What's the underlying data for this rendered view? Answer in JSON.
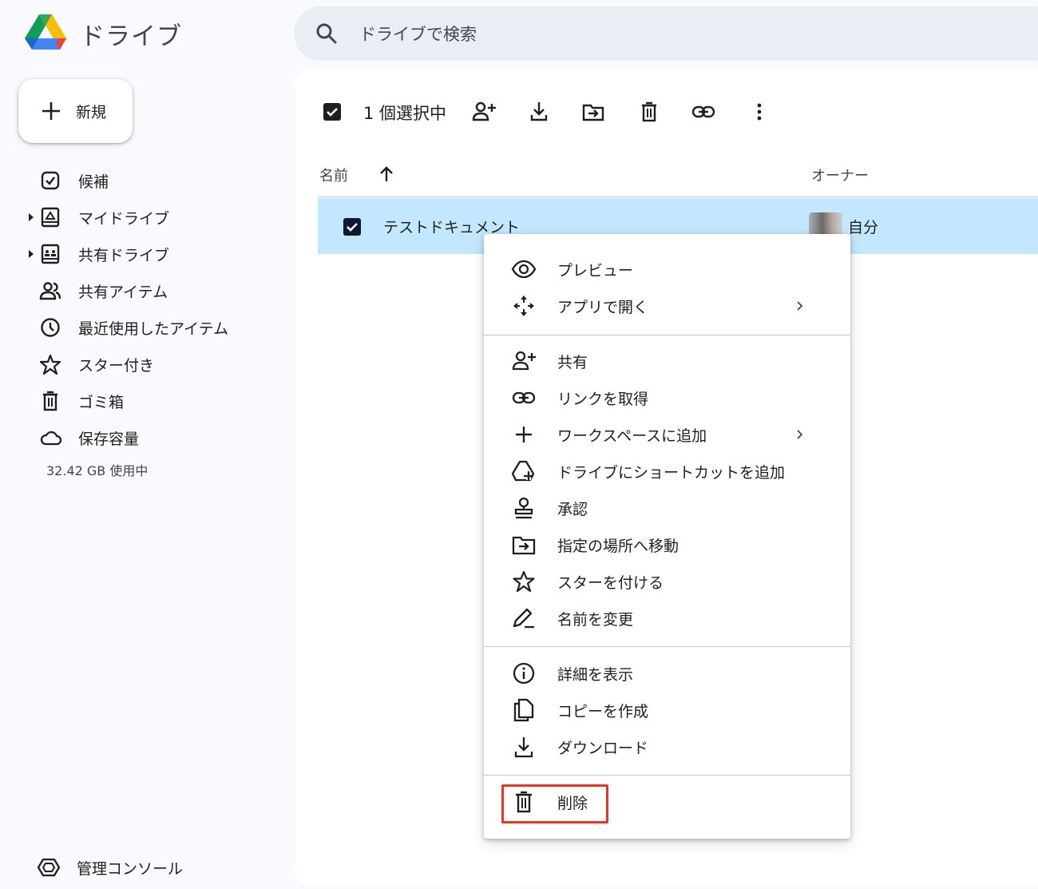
{
  "app": {
    "title": "ドライブ"
  },
  "search": {
    "placeholder": "ドライブで検索"
  },
  "sidebar": {
    "new_label": "新規",
    "items": [
      {
        "label": "候補",
        "icon": "suggested-icon"
      },
      {
        "label": "マイドライブ",
        "icon": "my-drive-icon",
        "expandable": true
      },
      {
        "label": "共有ドライブ",
        "icon": "shared-drives-icon",
        "expandable": true
      },
      {
        "label": "共有アイテム",
        "icon": "shared-with-me-icon"
      },
      {
        "label": "最近使用したアイテム",
        "icon": "recent-icon"
      },
      {
        "label": "スター付き",
        "icon": "star-icon"
      },
      {
        "label": "ゴミ箱",
        "icon": "trash-icon"
      },
      {
        "label": "保存容量",
        "icon": "cloud-icon"
      }
    ],
    "storage_text": "32.42 GB 使用中",
    "admin_label": "管理コンソール"
  },
  "toolbar": {
    "selected_text": "1 個選択中",
    "actions": [
      "share-icon",
      "download-icon",
      "move-icon",
      "trash-icon",
      "link-icon",
      "more-icon"
    ]
  },
  "list": {
    "columns": {
      "name": "名前",
      "owner": "オーナー"
    },
    "sort": "ascending",
    "rows": [
      {
        "name": "テストドキュメント",
        "owner": "自分",
        "selected": true
      }
    ]
  },
  "context_menu": {
    "groups": [
      [
        {
          "label": "プレビュー",
          "icon": "eye-icon"
        },
        {
          "label": "アプリで開く",
          "icon": "open-with-icon",
          "submenu": true
        }
      ],
      [
        {
          "label": "共有",
          "icon": "person-add-icon"
        },
        {
          "label": "リンクを取得",
          "icon": "link-icon"
        },
        {
          "label": "ワークスペースに追加",
          "icon": "plus-icon",
          "submenu": true
        },
        {
          "label": "ドライブにショートカットを追加",
          "icon": "add-shortcut-icon"
        },
        {
          "label": "承認",
          "icon": "approval-stamp-icon"
        },
        {
          "label": "指定の場所へ移動",
          "icon": "move-folder-icon"
        },
        {
          "label": "スターを付ける",
          "icon": "star-icon"
        },
        {
          "label": "名前を変更",
          "icon": "rename-pen-icon"
        }
      ],
      [
        {
          "label": "詳細を表示",
          "icon": "info-icon"
        },
        {
          "label": "コピーを作成",
          "icon": "copy-icon"
        },
        {
          "label": "ダウンロード",
          "icon": "download-icon"
        }
      ],
      [
        {
          "label": "削除",
          "icon": "trash-icon",
          "highlighted": true
        }
      ]
    ]
  },
  "colors": {
    "accent": "#0b57d0",
    "selected_row": "#c2e7ff",
    "highlight_box": "#ea3323",
    "search_bg": "#e9eef6"
  }
}
